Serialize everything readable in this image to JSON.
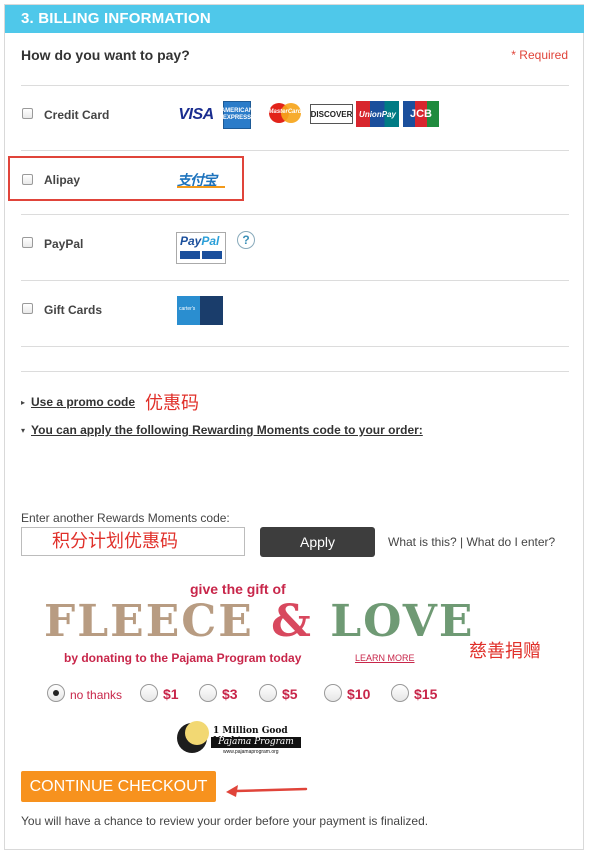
{
  "header": {
    "title": "3. BILLING INFORMATION"
  },
  "question": "How do you want to pay?",
  "required_note": "* Required",
  "payment_methods": [
    {
      "label": "Credit Card"
    },
    {
      "label": "Alipay"
    },
    {
      "label": "PayPal"
    },
    {
      "label": "Gift Cards"
    }
  ],
  "card_logos": {
    "visa": "VISA",
    "amex": "AMERICAN EXPRESS",
    "mastercard": "MasterCard",
    "discover": "DISCOVER",
    "unionpay": "UnionPay",
    "jcb": "JCB"
  },
  "alipay_logo": "支付宝",
  "paypal_logo": {
    "pay": "Pay",
    "pal": "Pal"
  },
  "help_icon": "?",
  "giftcard_logo": "carter's",
  "promo": {
    "link": "Use a promo code",
    "annotation": "优惠码",
    "rewards_link": "You can apply the following Rewarding Moments code to your order:"
  },
  "rewards": {
    "label": "Enter another Rewards Moments code:",
    "input_value": "积分计划优惠码",
    "apply_label": "Apply",
    "help_text": "What is this? | What do I enter?"
  },
  "fleece": {
    "top": "give the gift of",
    "big_fleece": "FLEECE",
    "big_and": "&",
    "big_love": "LOVE",
    "bottom": "by donating to the Pajama Program today",
    "learn": "LEARN MORE",
    "annotation": "慈善捐赠"
  },
  "donation_options": [
    {
      "label": "no thanks",
      "selected": true
    },
    {
      "label": "$1",
      "selected": false
    },
    {
      "label": "$3",
      "selected": false
    },
    {
      "label": "$5",
      "selected": false
    },
    {
      "label": "$10",
      "selected": false
    },
    {
      "label": "$15",
      "selected": false
    }
  ],
  "pajama_logo": {
    "line1": "1 Million Good Nights",
    "line2": "Pajama Program",
    "url": "www.pajamaprogram.org"
  },
  "continue_label": "CONTINUE CHECKOUT",
  "footer_note": "You will have a chance to review your order before your payment is finalized.",
  "colors": {
    "header": "#4fc8ea",
    "accent_red": "#e0443a",
    "cta": "#f7921e",
    "apply": "#3d3d3d"
  }
}
